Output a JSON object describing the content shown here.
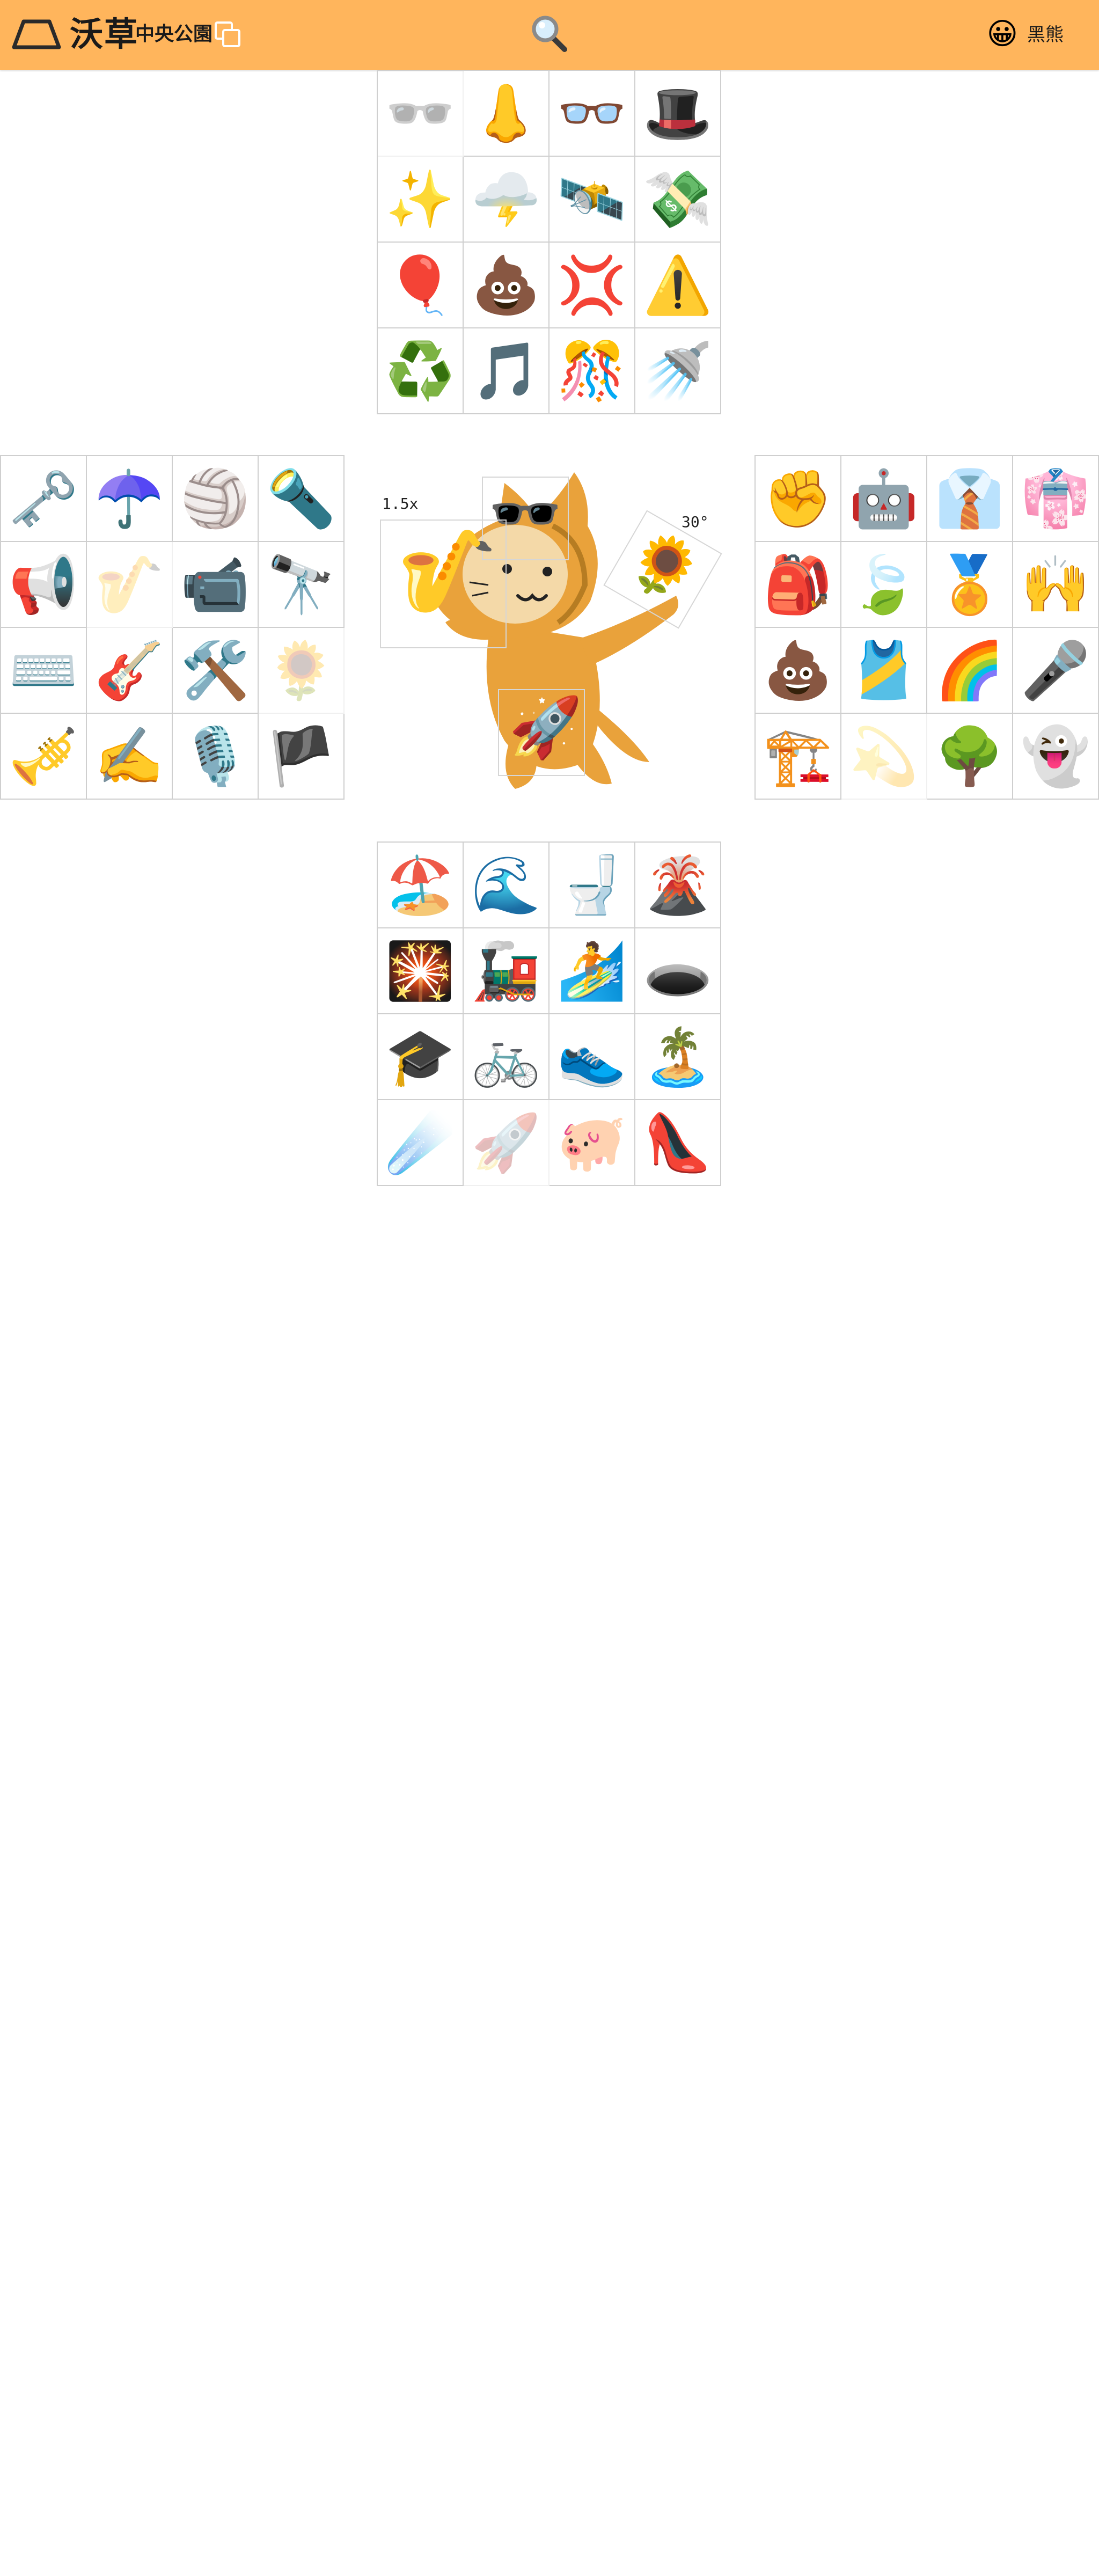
{
  "header": {
    "brand": "沃草",
    "subtitle": "中央公園",
    "logo_icon": "trapezoid-logo-icon",
    "copy_icon": "copy-icon",
    "search_icon": "magnifier-icon",
    "avatar_emoji": "😀",
    "username": "黑熊",
    "background_color": "#ffb55c"
  },
  "stage": {
    "scale_label": "1.5x",
    "rotation_label": "30°",
    "props": {
      "sunglasses": "🕶️",
      "saxophone": "🎷",
      "sunflower": "🌻",
      "rocket": "🚀"
    }
  },
  "grids": {
    "top": [
      {
        "emoji": "🕶️",
        "faded": true
      },
      {
        "emoji": "👃",
        "faded": false
      },
      {
        "emoji": "👓",
        "faded": false
      },
      {
        "emoji": "🎩",
        "faded": false
      },
      {
        "emoji": "✨",
        "faded": false
      },
      {
        "emoji": "🌩️",
        "faded": false
      },
      {
        "emoji": "🛰️",
        "faded": false
      },
      {
        "emoji": "💸",
        "faded": false
      },
      {
        "emoji": "🎈",
        "faded": false
      },
      {
        "emoji": "💩",
        "faded": false
      },
      {
        "emoji": "💢",
        "faded": false
      },
      {
        "emoji": "⚠️",
        "faded": false
      },
      {
        "emoji": "♻️",
        "faded": false
      },
      {
        "emoji": "🎵",
        "faded": false
      },
      {
        "emoji": "🎊",
        "faded": false
      },
      {
        "emoji": "🚿",
        "faded": false
      }
    ],
    "left": [
      {
        "emoji": "🗝️",
        "faded": false
      },
      {
        "emoji": "☂️",
        "faded": false
      },
      {
        "emoji": "🏐",
        "faded": false
      },
      {
        "emoji": "🔦",
        "faded": false
      },
      {
        "emoji": "📢",
        "faded": false
      },
      {
        "emoji": "🎷",
        "faded": true
      },
      {
        "emoji": "📹",
        "faded": false
      },
      {
        "emoji": "🔭",
        "faded": false
      },
      {
        "emoji": "⌨️",
        "faded": false
      },
      {
        "emoji": "🎸",
        "faded": false
      },
      {
        "emoji": "🛠️",
        "faded": false
      },
      {
        "emoji": "🌻",
        "faded": true
      },
      {
        "emoji": "🎺",
        "faded": false
      },
      {
        "emoji": "✍️",
        "faded": false
      },
      {
        "emoji": "🎙️",
        "faded": false
      },
      {
        "emoji": "🏴",
        "faded": false
      }
    ],
    "right": [
      {
        "emoji": "✊",
        "faded": false
      },
      {
        "emoji": "🤖",
        "faded": false
      },
      {
        "emoji": "👔",
        "faded": false
      },
      {
        "emoji": "👘",
        "faded": false
      },
      {
        "emoji": "🎒",
        "faded": false
      },
      {
        "emoji": "🍃",
        "faded": false
      },
      {
        "emoji": "🏅",
        "faded": false
      },
      {
        "emoji": "🙌",
        "faded": false
      },
      {
        "emoji": "💩",
        "faded": false
      },
      {
        "emoji": "🎽",
        "faded": false
      },
      {
        "emoji": "🌈",
        "faded": false
      },
      {
        "emoji": "🎤",
        "faded": false
      },
      {
        "emoji": "🏗️",
        "faded": false
      },
      {
        "emoji": "💫",
        "faded": true
      },
      {
        "emoji": "🌳",
        "faded": false
      },
      {
        "emoji": "👻",
        "faded": false
      }
    ],
    "bottom": [
      {
        "emoji": "🏖️",
        "faded": false
      },
      {
        "emoji": "🌊",
        "faded": false
      },
      {
        "emoji": "🚽",
        "faded": false
      },
      {
        "emoji": "🌋",
        "faded": false
      },
      {
        "emoji": "🎇",
        "faded": false
      },
      {
        "emoji": "🚂",
        "faded": false
      },
      {
        "emoji": "🏄",
        "faded": false
      },
      {
        "emoji": "🕳️",
        "faded": false
      },
      {
        "emoji": "🎓",
        "faded": false
      },
      {
        "emoji": "🚲",
        "faded": false
      },
      {
        "emoji": "👟",
        "faded": false
      },
      {
        "emoji": "🏝️",
        "faded": false
      },
      {
        "emoji": "☄️",
        "faded": false
      },
      {
        "emoji": "🚀",
        "faded": true
      },
      {
        "emoji": "🐖",
        "faded": false
      },
      {
        "emoji": "👠",
        "faded": false
      }
    ]
  }
}
